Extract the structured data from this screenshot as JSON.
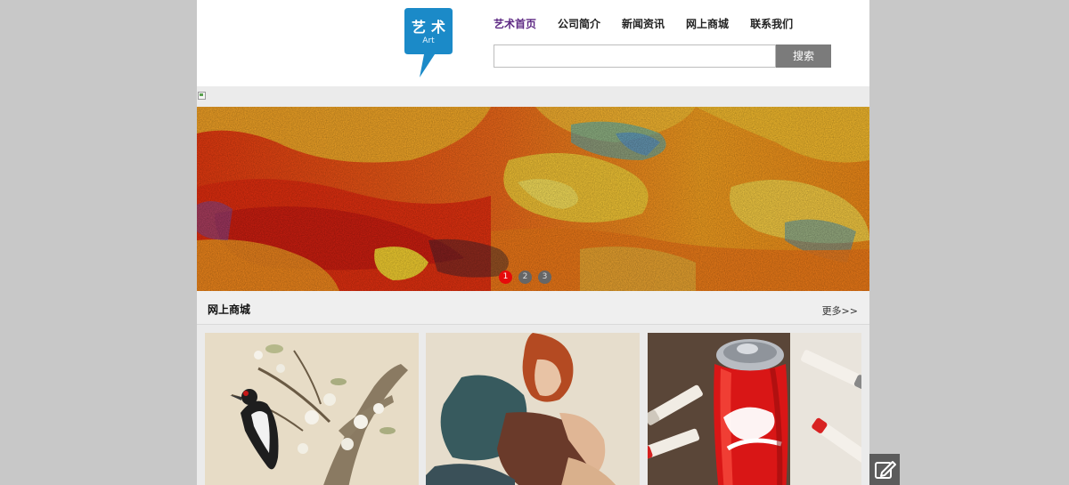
{
  "logo": {
    "title": "艺术",
    "subtitle": "Art"
  },
  "nav": [
    {
      "label": "艺术首页"
    },
    {
      "label": "公司简介"
    },
    {
      "label": "新闻资讯"
    },
    {
      "label": "网上商城"
    },
    {
      "label": "联系我们"
    }
  ],
  "search": {
    "value": "",
    "button_label": "搜索"
  },
  "slider": {
    "dots": [
      "1",
      "2",
      "3"
    ],
    "active_index": 0
  },
  "section": {
    "title": "网上商城",
    "more_label": "更多>>"
  },
  "products": [
    {
      "image": "woodpecker-on-flowering-branch-painting"
    },
    {
      "image": "seated-woman-red-hair-painting"
    },
    {
      "image": "coca-cola-can-marker-drawing"
    }
  ],
  "colors": {
    "nav_active": "#5e2a84",
    "logo": "#1b8ac8",
    "dot_active": "#e60b0b",
    "search_button": "#7b7b7b"
  }
}
